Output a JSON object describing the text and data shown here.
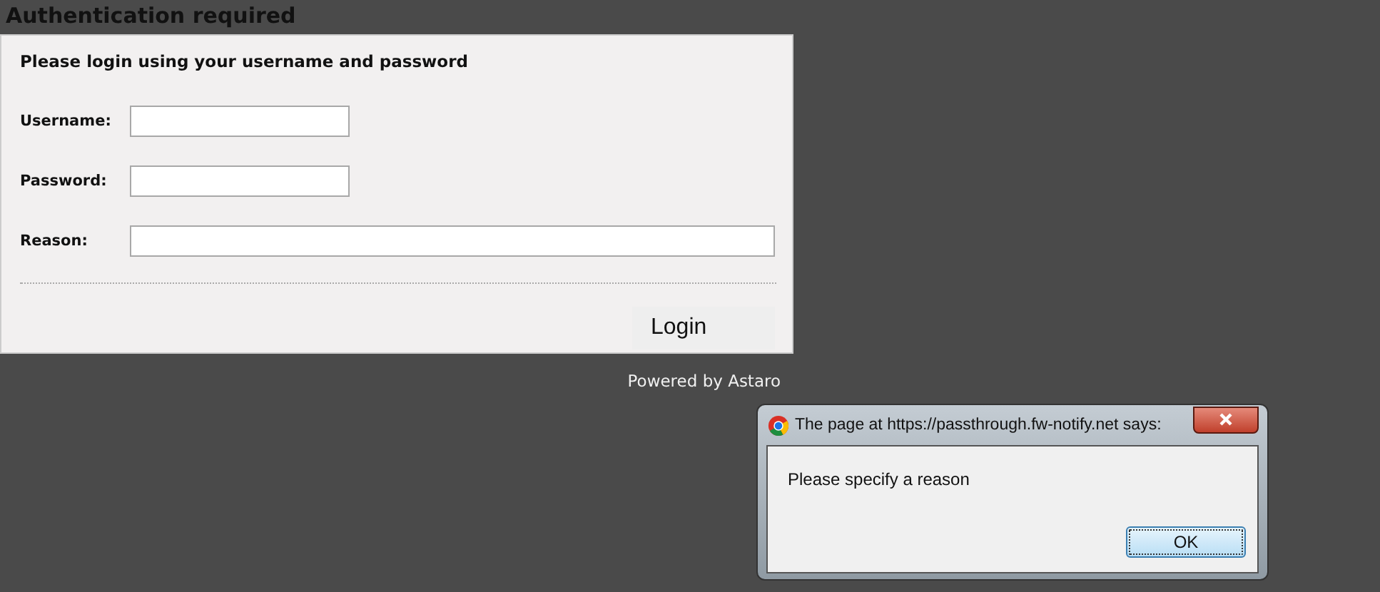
{
  "page_title": "Authentication required",
  "form": {
    "intro": "Please login using your username and password",
    "fields": [
      {
        "label": "Username:",
        "kind": "short"
      },
      {
        "label": "Password:",
        "kind": "short"
      },
      {
        "label": "Reason:",
        "kind": "wide"
      }
    ],
    "submit": "Login"
  },
  "footer": "Powered by Astaro",
  "dialog": {
    "title": "The page at https://passthrough.fw-notify.net says:",
    "message": "Please specify a reason",
    "button": "OK"
  }
}
